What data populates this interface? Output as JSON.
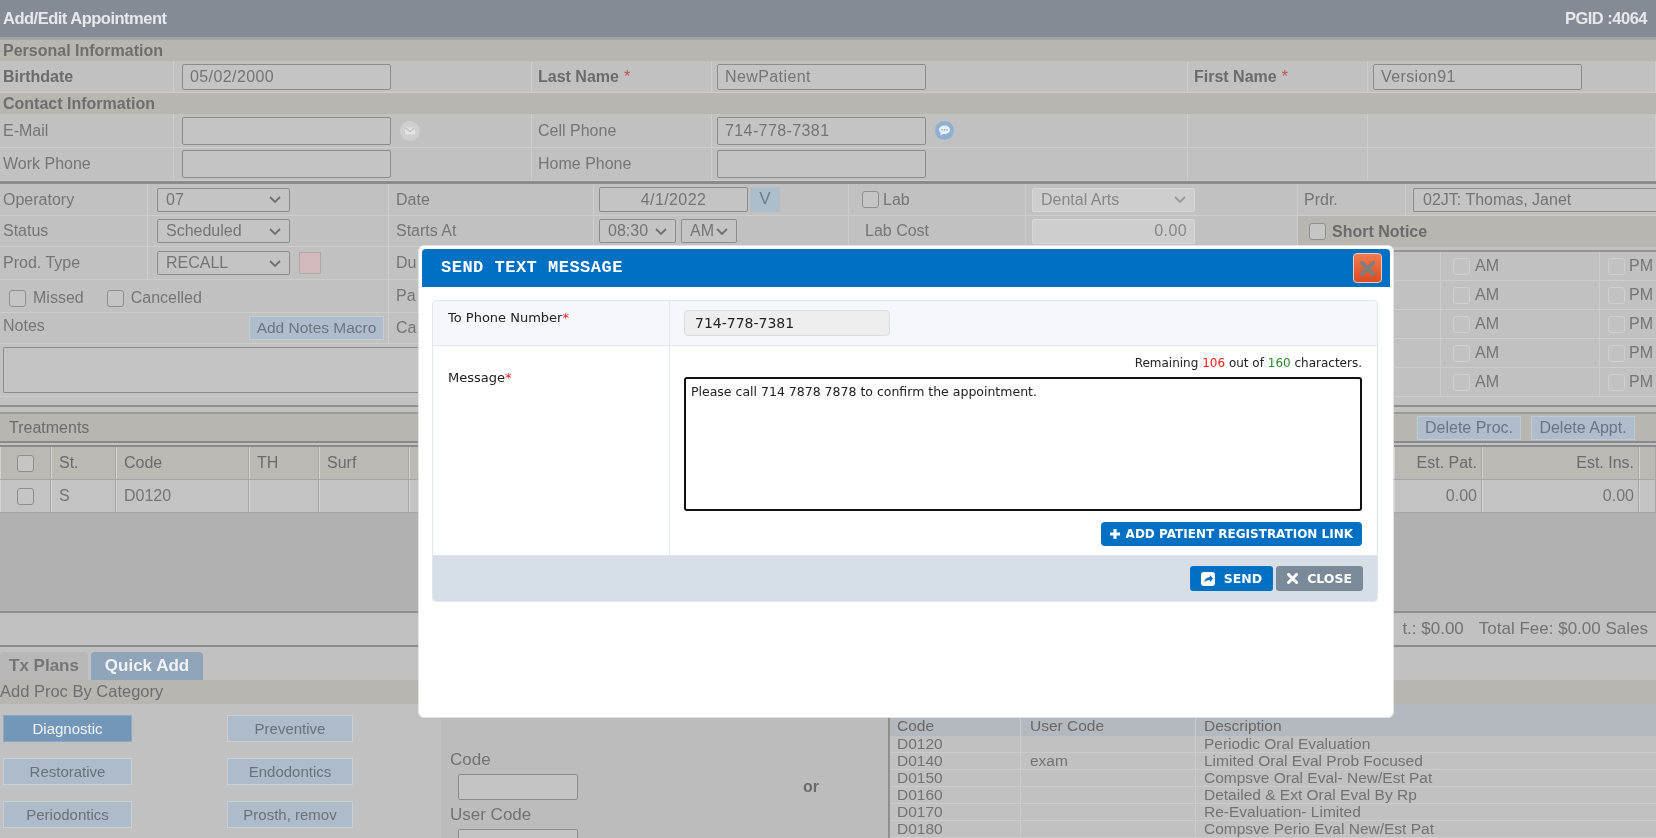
{
  "window": {
    "title": "Add/Edit Appointment",
    "page_id": "PGID :4064"
  },
  "personal_information": {
    "heading": "Personal Information",
    "fields": [
      {
        "label": "Birthdate",
        "value": "05/02/2000"
      },
      {
        "label": "Last Name",
        "mark": "*",
        "value": "NewPatient"
      },
      {
        "label": "First Name",
        "mark": "*",
        "value": "Version91"
      }
    ]
  },
  "contact_information": {
    "heading": "Contact Information",
    "fields": [
      {
        "kind": "email",
        "label": "E-Mail"
      },
      {
        "kind": "mobile",
        "label": "Cell Phone",
        "value": "714-778-7381"
      },
      {
        "kind": "phone",
        "label": "Work Phone"
      },
      {
        "kind": "phone",
        "label": "Home Phone"
      }
    ]
  },
  "appointment": {
    "operatory": {
      "label": "Operatory",
      "value": "07"
    },
    "status": {
      "label": "Status",
      "value": "Scheduled"
    },
    "prod_type": {
      "label": "Prod. Type",
      "value": "RECALL"
    },
    "flags": [
      {
        "label": "Missed",
        "checked": false
      },
      {
        "label": "Cancelled",
        "checked": false
      }
    ],
    "notes": {
      "label": "Notes",
      "macro_button": "Add Notes Macro"
    },
    "date": {
      "label": "Date",
      "value": "4/1/2022",
      "button": "V"
    },
    "starts_at": {
      "label": "Starts At",
      "time": "08:30",
      "period": "AM"
    },
    "partial_labels": [
      "Du",
      "Pa",
      "Ca"
    ],
    "lab": {
      "label": "Lab",
      "checked": false,
      "vendor": "Dental Arts",
      "disabled": true
    },
    "lab_cost": {
      "label": "Lab Cost",
      "value": "0.00",
      "disabled": true
    },
    "provider": {
      "label": "Prdr.",
      "value": "02JT: Thomas, Janet"
    },
    "short_notice": {
      "label": "Short Notice",
      "checked": false
    },
    "time_slots": [
      {
        "am": {
          "label": "AM",
          "checked": false
        },
        "pm": {
          "label": "PM",
          "checked": false
        }
      },
      {
        "am": {
          "label": "AM",
          "checked": false
        },
        "pm": {
          "label": "PM",
          "checked": false
        }
      },
      {
        "am": {
          "label": "AM",
          "checked": false
        },
        "pm": {
          "label": "PM",
          "checked": false
        }
      },
      {
        "am": {
          "label": "AM",
          "checked": false
        },
        "pm": {
          "label": "PM",
          "checked": false
        }
      },
      {
        "am": {
          "label": "AM",
          "checked": false
        },
        "pm": {
          "label": "PM",
          "checked": false
        }
      }
    ]
  },
  "treatments": {
    "title": "Treatments",
    "buttons": [
      "Delete Proc.",
      "Delete Appt."
    ],
    "select_all": {
      "checked": false
    },
    "columns": [
      "St.",
      "Code",
      "TH",
      "Surf"
    ],
    "right_columns": [
      "Est. Pat.",
      "Est. Ins."
    ],
    "rows": [
      {
        "checked": false,
        "status": "S",
        "code": "D0120",
        "est_pat": "0.00",
        "est_ins": "0.00"
      }
    ],
    "totals": [
      "t.: $0.00",
      "Total Fee: $0.00 Sales"
    ]
  },
  "tabs": [
    {
      "label": "Tx Plans",
      "selected": false
    },
    {
      "label": "Quick Add",
      "selected": true
    }
  ],
  "quick_add": {
    "heading": "Add Proc By Category",
    "categories": [
      {
        "label": "Diagnostic",
        "selected": true
      },
      {
        "label": "Preventive",
        "selected": false
      },
      {
        "label": "Restorative",
        "selected": false
      },
      {
        "label": "Endodontics",
        "selected": false
      },
      {
        "label": "Periodontics",
        "selected": false
      },
      {
        "label": "Prosth, remov",
        "selected": false
      }
    ],
    "code_label": "Code",
    "or_text": "or",
    "user_code_label": "User Code"
  },
  "procedure_list": {
    "columns": [
      "Code",
      "User Code",
      "Description"
    ],
    "rows": [
      {
        "code": "D0120",
        "description": "Periodic Oral Evaluation"
      },
      {
        "code": "D0140",
        "user_code": "exam",
        "description": "Limited Oral Eval Prob Focused"
      },
      {
        "code": "D0150",
        "description": "Compsve Oral Eval- New/Est Pat"
      },
      {
        "code": "D0160",
        "description": "Detailed & Ext Oral Eval By Rp"
      },
      {
        "code": "D0170",
        "description": "Re-Evaluation- Limited"
      },
      {
        "code": "D0180",
        "description": "Compsve Perio Eval New/Est Pat"
      }
    ]
  },
  "send_text_dialog": {
    "title": "SEND TEXT MESSAGE",
    "phone": {
      "label": "To Phone Number",
      "mark": "*",
      "value": "714-778-7381"
    },
    "message": {
      "label": "Message",
      "mark": "*",
      "value": "Please call 714 7878 7878 to confirm the appointment."
    },
    "counter": {
      "prefix": "Remaining ",
      "remaining": "106",
      "middle": " out of ",
      "limit": "160",
      "suffix": " characters."
    },
    "link_button": "ADD PATIENT REGISTRATION LINK",
    "buttons": [
      {
        "kind": "send",
        "label": "SEND"
      },
      {
        "kind": "close",
        "label": "CLOSE"
      }
    ]
  }
}
